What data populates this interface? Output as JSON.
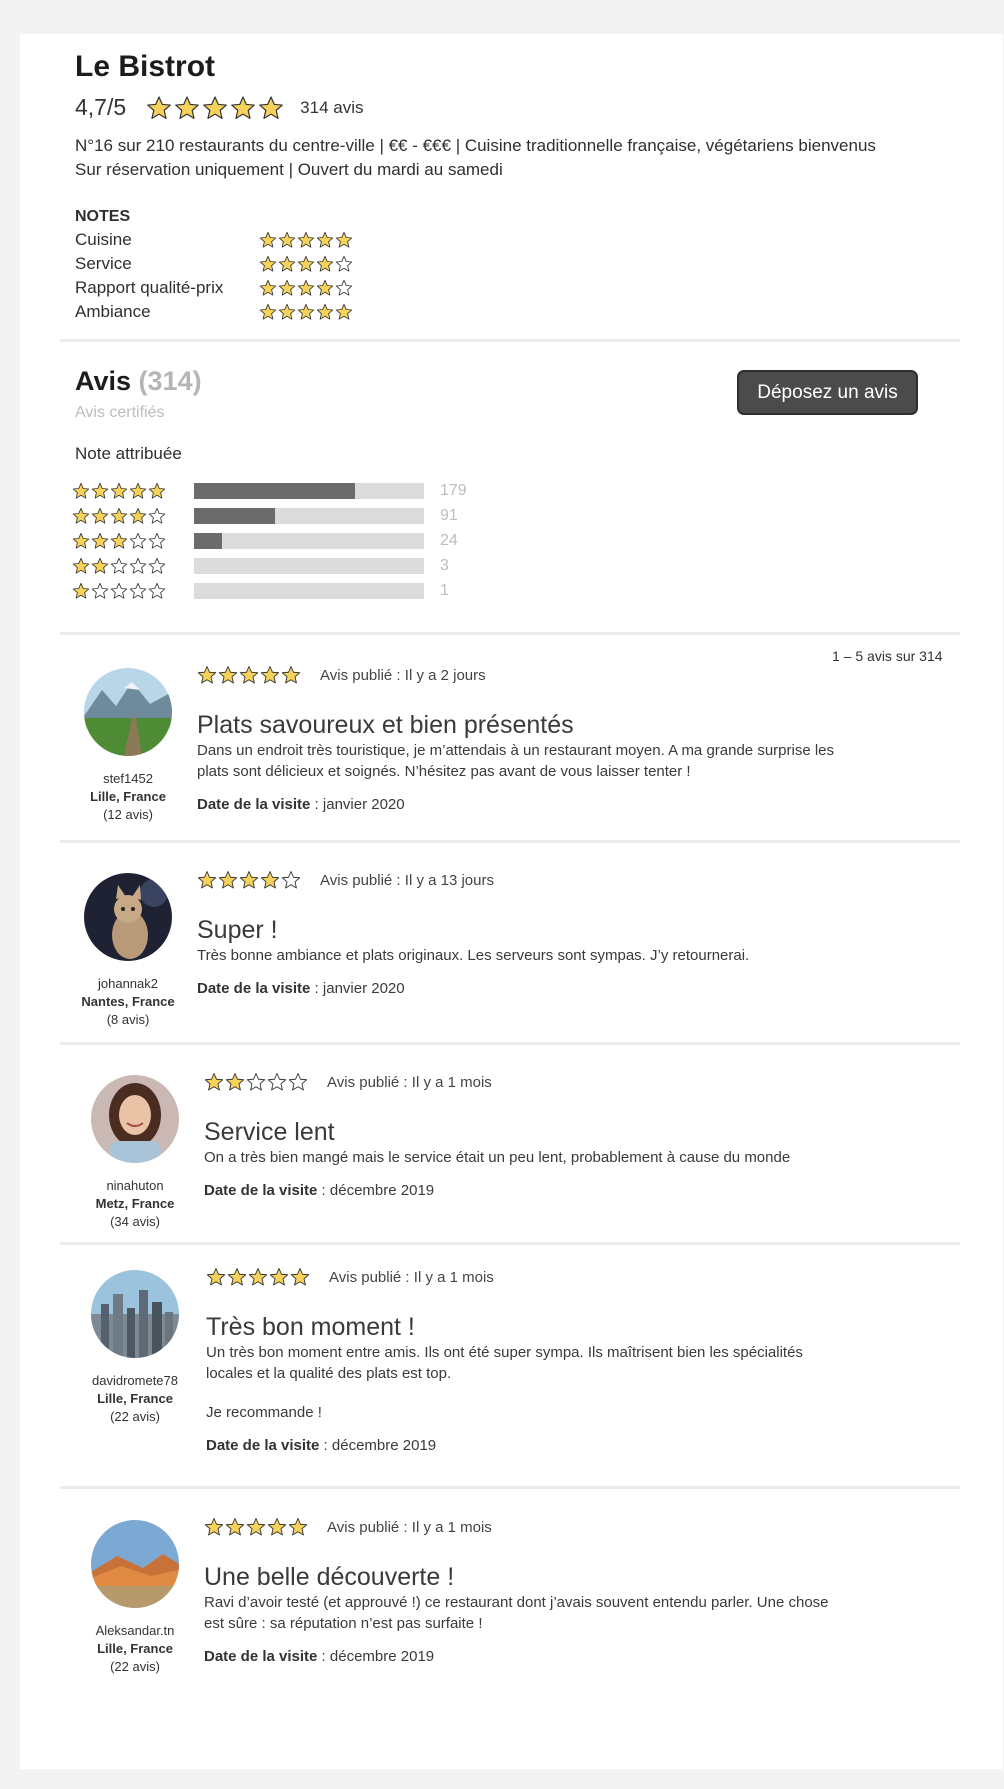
{
  "restaurant": {
    "name": "Le Bistrot",
    "score": "4,7/5",
    "rating": 5,
    "review_count_label": "314 avis",
    "info_line_1": "N°16 sur 210 restaurants du centre-ville | €€ - €€€ | Cuisine traditionnelle française, végétariens bienvenus",
    "info_line_2": "Sur réservation uniquement | Ouvert du mardi au samedi"
  },
  "notes": {
    "heading": "NOTES",
    "items": [
      {
        "label": "Cuisine",
        "stars": 5
      },
      {
        "label": "Service",
        "stars": 4
      },
      {
        "label": "Rapport qualité-prix",
        "stars": 4
      },
      {
        "label": "Ambiance",
        "stars": 5
      }
    ]
  },
  "reviews_section": {
    "title": "Avis",
    "count": "(314)",
    "certified": "Avis certifiés",
    "deposit_button": "Déposez un avis",
    "note_attribuee": "Note attribuée",
    "pagination": "1 – 5 avis sur 314",
    "distribution": [
      {
        "stars": 5,
        "count": 179,
        "fill": 0.7
      },
      {
        "stars": 4,
        "count": 91,
        "fill": 0.35
      },
      {
        "stars": 3,
        "count": 24,
        "fill": 0.12
      },
      {
        "stars": 2,
        "count": 3,
        "fill": 0
      },
      {
        "stars": 1,
        "count": 1,
        "fill": 0
      }
    ]
  },
  "colors": {
    "star_fill": "#f7d25a",
    "star_stroke": "#333333",
    "bar_fill": "#6b6b6b",
    "bar_track": "#dcdcdc",
    "button_bg": "#4b4b4b"
  },
  "reviews": [
    {
      "stars": 5,
      "published": "Avis publié : Il y a 2 jours",
      "title": "Plats savoureux et bien présentés",
      "text": [
        "Dans un endroit très touristique, je m’attendais à un restaurant moyen. A ma grande surprise les plats sont délicieux et soignés. N’hésitez pas avant de vous laisser tenter !"
      ],
      "visit_label": "Date de la visite",
      "visit_value": " : janvier 2020",
      "user": "stef1452",
      "location": "Lille, France",
      "user_reviews": "(12 avis)",
      "avatar_icon": "landscape-photo-avatar"
    },
    {
      "stars": 4,
      "published": "Avis publié : Il y a 13 jours",
      "title": "Super !",
      "text": [
        "Très bonne ambiance et plats originaux. Les serveurs sont sympas. J’y retournerai."
      ],
      "visit_label": "Date de la visite",
      "visit_value": " : janvier 2020",
      "user": "johannak2",
      "location": "Nantes, France",
      "user_reviews": "(8 avis)",
      "avatar_icon": "cat-photo-avatar"
    },
    {
      "stars": 2,
      "published": "Avis publié : Il y a 1 mois",
      "title": "Service lent",
      "text": [
        "On a très bien mangé mais le service était un peu lent, probablement à cause du monde"
      ],
      "visit_label": "Date de la visite",
      "visit_value": " : décembre 2019",
      "user": "ninahuton",
      "location": "Metz, France",
      "user_reviews": "(34 avis)",
      "avatar_icon": "woman-photo-avatar"
    },
    {
      "stars": 5,
      "published": "Avis publié : Il y a 1 mois",
      "title": "Très bon moment !",
      "text": [
        "Un très bon moment entre amis. Ils ont été super sympa. Ils maîtrisent bien les spécialités locales et la qualité des plats est top.",
        "Je recommande !"
      ],
      "visit_label": "Date de la visite",
      "visit_value": " : décembre 2019",
      "user": "davidromete78",
      "location": "Lille, France",
      "user_reviews": "(22 avis)",
      "avatar_icon": "city-photo-avatar"
    },
    {
      "stars": 5,
      "published": "Avis publié : Il y a 1 mois",
      "title": "Une belle découverte !",
      "text": [
        "Ravi d’avoir testé (et approuvé !) ce restaurant dont j’avais souvent entendu parler. Une chose est sûre : sa réputation n’est pas surfaite !"
      ],
      "visit_label": "Date de la visite",
      "visit_value": " : décembre 2019",
      "user": "Aleksandar.tn",
      "location": "Lille, France",
      "user_reviews": "(22 avis)",
      "avatar_icon": "desert-photo-avatar"
    }
  ]
}
